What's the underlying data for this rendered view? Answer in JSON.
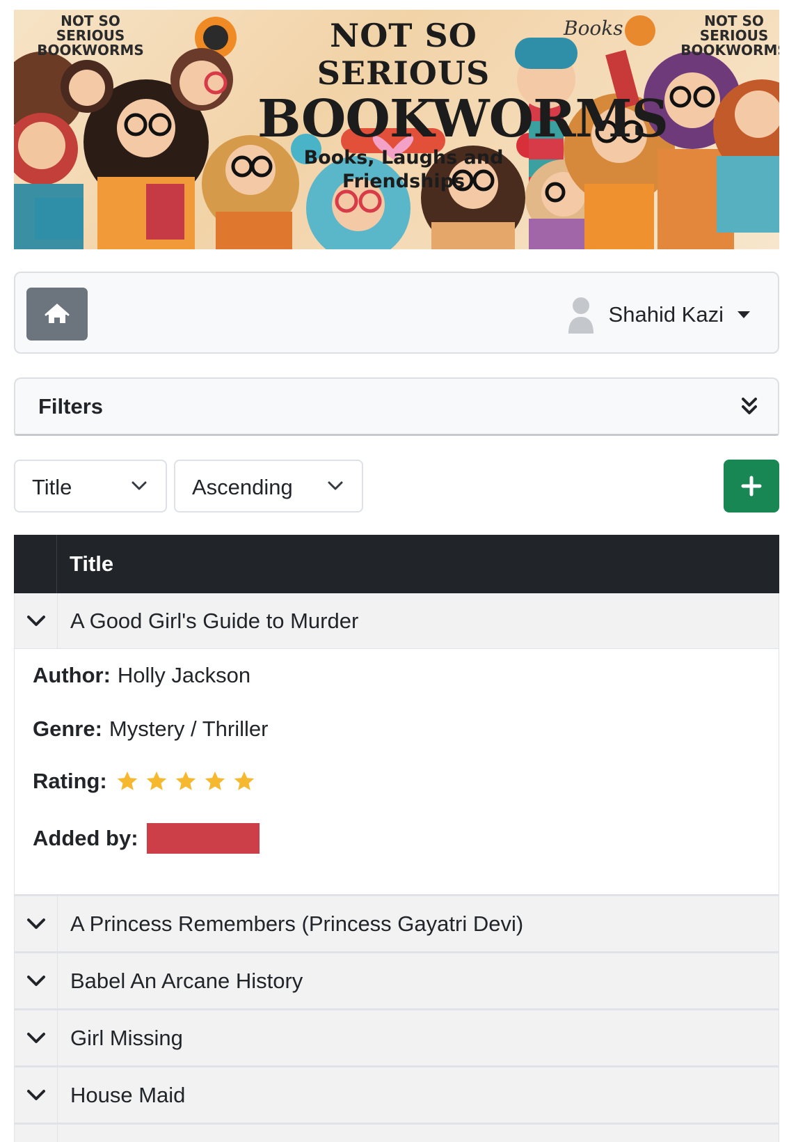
{
  "banner": {
    "corner_text": "NOT SO SERIOUS BOOKWORMS",
    "corner_line1": "NOT SO",
    "corner_line2": "SERIOUS",
    "corner_line3": "BOOKWORMS",
    "title_line1": "NOT SO SERIOUS",
    "title_line2": "BOOKWORMS",
    "tagline": "Books, Laughs and Friendships",
    "books_word": "Books"
  },
  "navbar": {
    "home_icon": "home-icon",
    "user_icon": "user-silhouette-icon",
    "user_name": "Shahid Kazi"
  },
  "filters": {
    "label": "Filters",
    "icon": "double-chevron-down-icon"
  },
  "sort": {
    "field_value": "Title",
    "order_value": "Ascending",
    "add_icon": "plus-icon"
  },
  "table": {
    "header": "Title",
    "rows": [
      {
        "title": "A Good Girl's Guide to Murder"
      },
      {
        "title": "A Princess Remembers (Princess Gayatri Devi)"
      },
      {
        "title": "Babel An Arcane History"
      },
      {
        "title": "Girl Missing"
      },
      {
        "title": "House Maid"
      }
    ],
    "expanded": {
      "author_label": "Author:",
      "author": "Holly Jackson",
      "genre_label": "Genre:",
      "genre": "Mystery / Thriller",
      "rating_label": "Rating:",
      "rating": 5,
      "rating_max": 5,
      "added_by_label": "Added by:"
    }
  },
  "colors": {
    "home_button": "#6c757d",
    "add_button": "#198754",
    "table_header": "#212529",
    "star": "#f5b82e",
    "redaction": "#cc3f48"
  }
}
